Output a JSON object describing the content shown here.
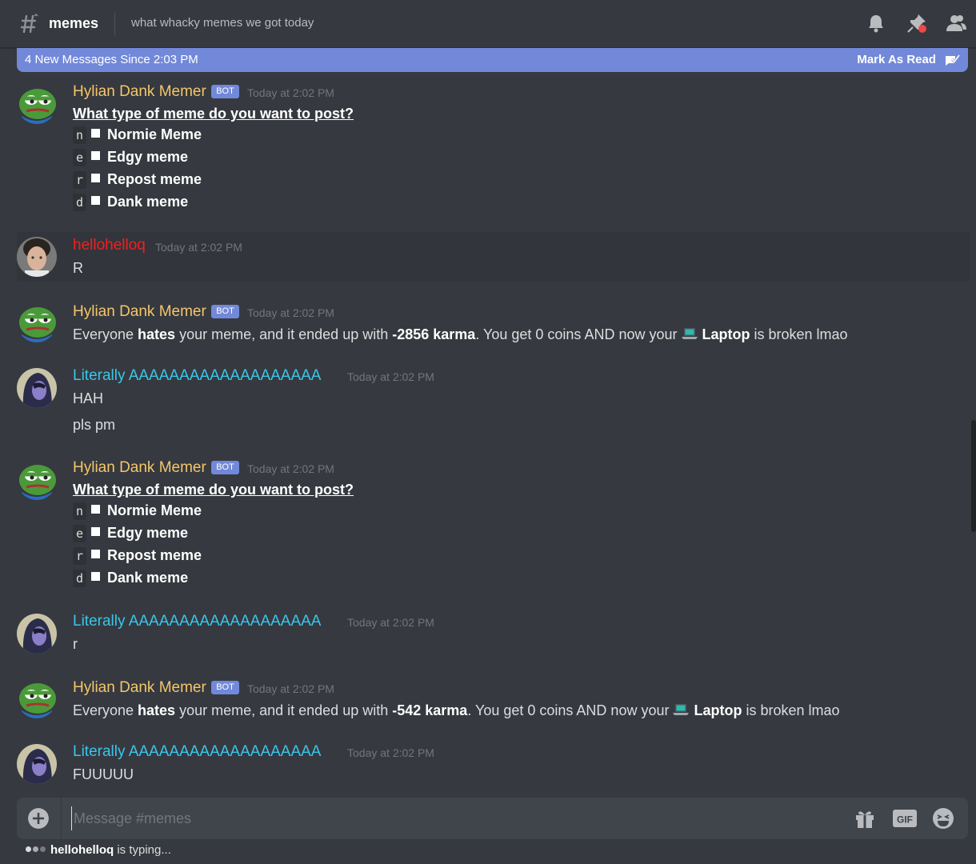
{
  "header": {
    "channel_name": "memes",
    "topic": "what whacky memes we got today",
    "icons": [
      "bell-icon",
      "pin-icon",
      "members-icon"
    ]
  },
  "new_messages_bar": {
    "text": "4 New Messages Since 2:03 PM",
    "action": "Mark As Read"
  },
  "messages": [
    {
      "author": "Hylian Dank Memer",
      "bot_tag": "BOT",
      "time": "Today at 2:02 PM",
      "question": "What type of meme do you want to post?",
      "options": [
        {
          "key": "n",
          "label": "Normie Meme"
        },
        {
          "key": "e",
          "label": "Edgy meme"
        },
        {
          "key": "r",
          "label": "Repost meme"
        },
        {
          "key": "d",
          "label": "Dank meme"
        }
      ]
    },
    {
      "author": "hellohelloq",
      "time": "Today at 2:02 PM",
      "text": "R"
    },
    {
      "author": "Hylian Dank Memer",
      "bot_tag": "BOT",
      "time": "Today at 2:02 PM",
      "parts": [
        "Everyone ",
        "hates",
        " your meme, and it ended up with ",
        "-2856 karma",
        ". You get 0 coins AND now your ",
        "Laptop",
        " is broken lmao"
      ]
    },
    {
      "author": "Literally AAAAAAAAAAAAAAAAAAA",
      "time": "Today at 2:02 PM",
      "lines": [
        "HAH",
        "pls pm"
      ]
    },
    {
      "author": "Hylian Dank Memer",
      "bot_tag": "BOT",
      "time": "Today at 2:02 PM",
      "question": "What type of meme do you want to post?",
      "options": [
        {
          "key": "n",
          "label": "Normie Meme"
        },
        {
          "key": "e",
          "label": "Edgy meme"
        },
        {
          "key": "r",
          "label": "Repost meme"
        },
        {
          "key": "d",
          "label": "Dank meme"
        }
      ]
    },
    {
      "author": "Literally AAAAAAAAAAAAAAAAAAA",
      "time": "Today at 2:02 PM",
      "text": "r"
    },
    {
      "author": "Hylian Dank Memer",
      "bot_tag": "BOT",
      "time": "Today at 2:02 PM",
      "parts": [
        "Everyone ",
        "hates",
        " your meme, and it ended up with ",
        "-542 karma",
        ". You get 0 coins AND now your ",
        "Laptop",
        " is broken lmao"
      ]
    },
    {
      "author": "Literally AAAAAAAAAAAAAAAAAAA",
      "time": "Today at 2:02 PM",
      "text": "FUUUUU"
    }
  ],
  "composer": {
    "placeholder": "Message #memes",
    "gif_label": "GIF"
  },
  "typing": {
    "user": "hellohelloq",
    "suffix": " is typing..."
  },
  "colors": {
    "background": "#36393f",
    "blurple": "#7289da",
    "bot_author": "#f4c66a",
    "user_red": "#f21f1f",
    "user_cyan": "#38c7ec"
  }
}
